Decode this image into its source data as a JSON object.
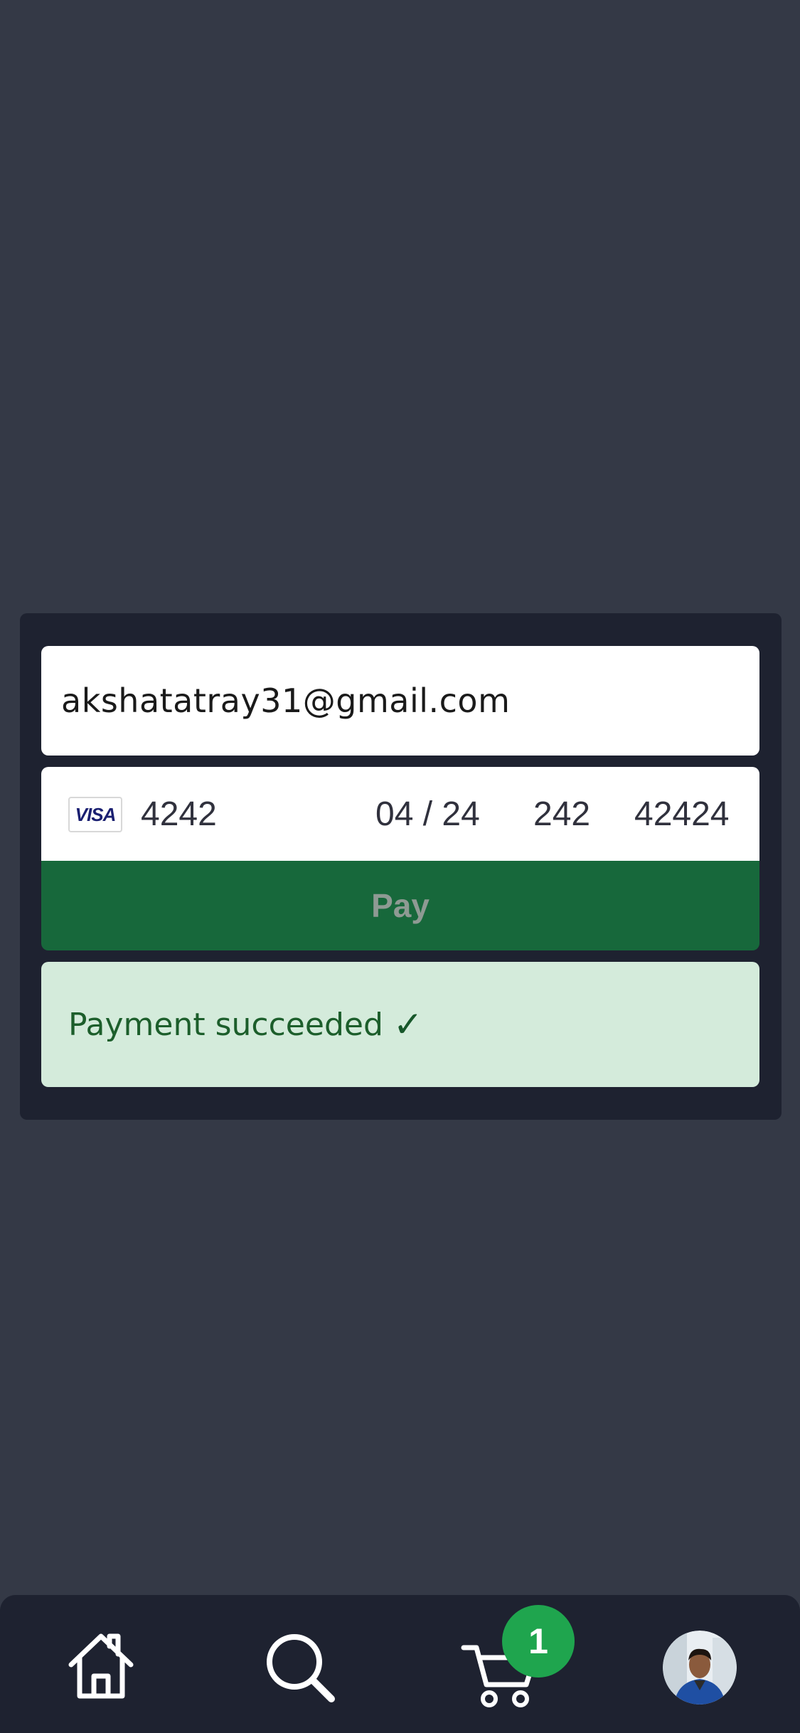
{
  "checkout": {
    "email_value": "akshatatray31@gmail.com",
    "card": {
      "brand": "VISA",
      "number": "4242",
      "expiry": "04 / 24",
      "cvc": "242",
      "zip": "42424"
    },
    "pay_label": "Pay",
    "status_text": "Payment succeeded",
    "status_mark": "✓"
  },
  "tab_bar": {
    "items": [
      {
        "icon": "home-icon"
      },
      {
        "icon": "search-icon"
      },
      {
        "icon": "cart-icon"
      },
      {
        "icon": "avatar"
      }
    ],
    "cart_count": "1"
  },
  "colors": {
    "background": "#343946",
    "card": "#1e2230",
    "pay_button": "#17683b",
    "success_bg": "#d4ebdb",
    "success_text": "#1c5e2b",
    "badge": "#1fa54e"
  }
}
